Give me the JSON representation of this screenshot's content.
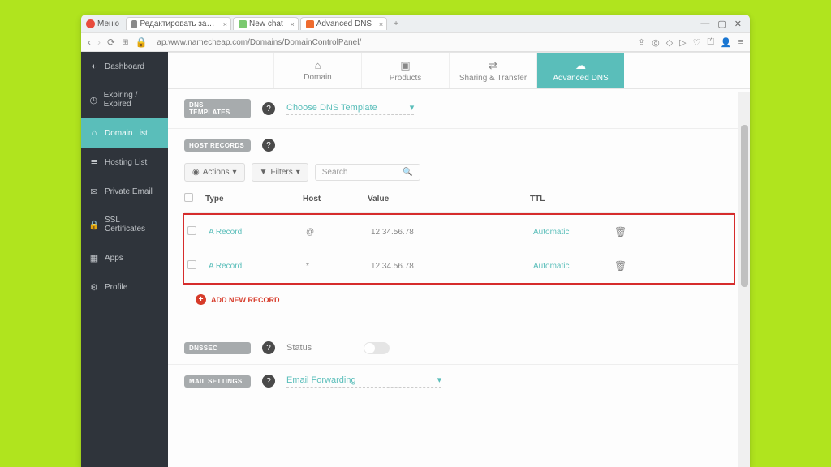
{
  "browser": {
    "menu_label": "Меню",
    "tabs": [
      {
        "label": "Редактировать запись \"Б…"
      },
      {
        "label": "New chat"
      },
      {
        "label": "Advanced DNS"
      }
    ],
    "url": "ap.www.namecheap.com/Domains/DomainControlPanel/"
  },
  "sidebar": {
    "items": [
      {
        "label": "Dashboard"
      },
      {
        "label": "Expiring / Expired"
      },
      {
        "label": "Domain List"
      },
      {
        "label": "Hosting List"
      },
      {
        "label": "Private Email"
      },
      {
        "label": "SSL Certificates"
      },
      {
        "label": "Apps"
      },
      {
        "label": "Profile"
      }
    ]
  },
  "toptabs": {
    "domain": "Domain",
    "products": "Products",
    "sharing": "Sharing & Transfer",
    "advanced": "Advanced DNS"
  },
  "dns_templates": {
    "title": "DNS TEMPLATES",
    "select": "Choose DNS Template"
  },
  "host_records": {
    "title": "HOST RECORDS",
    "actions": "Actions",
    "filters": "Filters",
    "search_placeholder": "Search",
    "headers": {
      "type": "Type",
      "host": "Host",
      "value": "Value",
      "ttl": "TTL"
    },
    "rows": [
      {
        "type": "A Record",
        "host": "@",
        "value": "12.34.56.78",
        "ttl": "Automatic"
      },
      {
        "type": "A Record",
        "host": "*",
        "value": "12.34.56.78",
        "ttl": "Automatic"
      }
    ],
    "add": "ADD NEW RECORD"
  },
  "dnssec": {
    "title": "DNSSEC",
    "status": "Status"
  },
  "mail": {
    "title": "MAIL SETTINGS",
    "select": "Email Forwarding"
  }
}
